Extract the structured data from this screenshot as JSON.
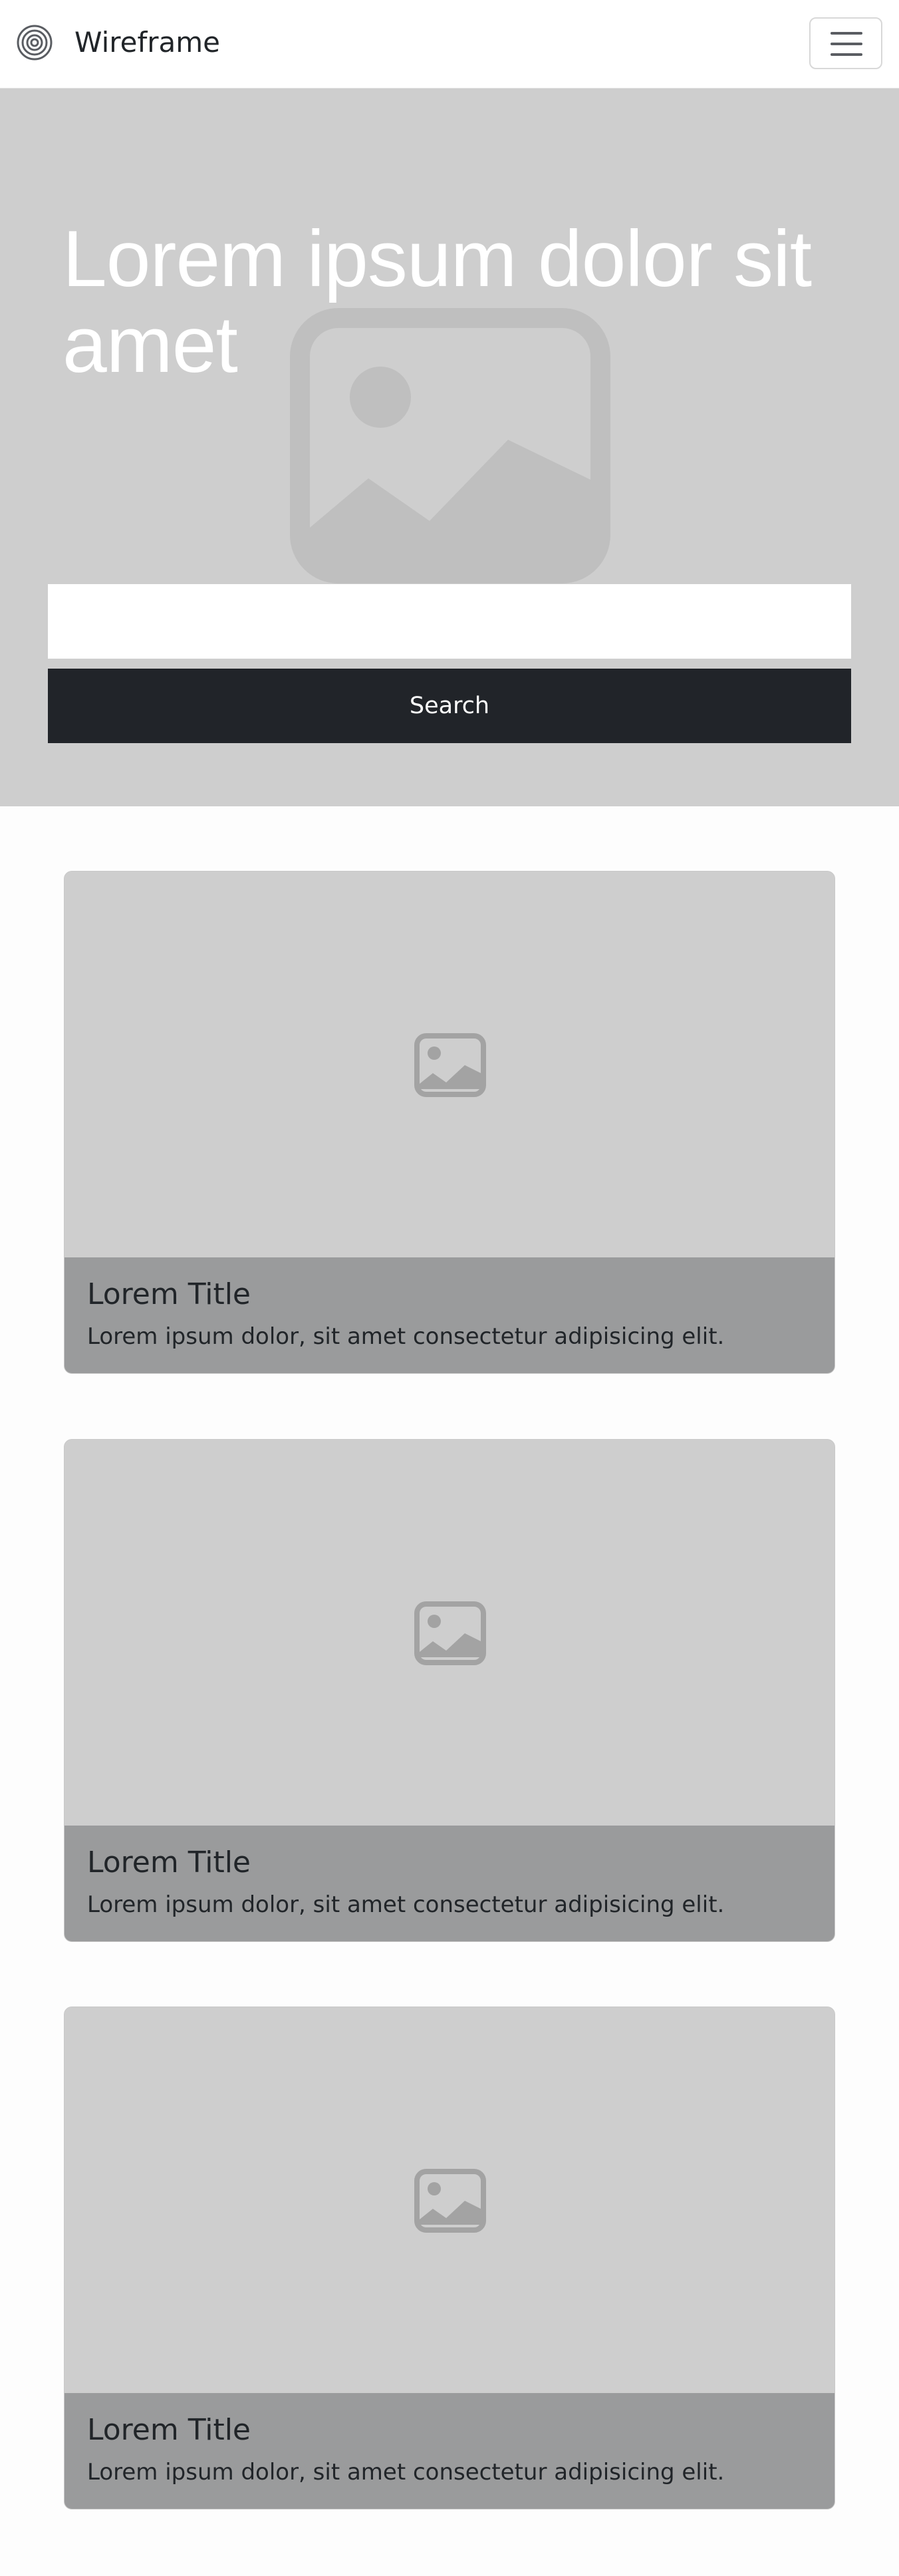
{
  "navbar": {
    "brand": "Wireframe",
    "logo_icon": "concentric-circles-logo",
    "menu_icon": "hamburger-icon"
  },
  "hero": {
    "title": "Lorem ipsum dolor sit amet",
    "search_placeholder": "",
    "search_value": "",
    "search_button_label": "Search",
    "background_color": "#cecece",
    "button_color": "#212429"
  },
  "cards": [
    {
      "title": "Lorem Title",
      "text": "Lorem ipsum dolor, sit amet consectetur adipisicing elit."
    },
    {
      "title": "Lorem Title",
      "text": "Lorem ipsum dolor, sit amet consectetur adipisicing elit."
    },
    {
      "title": "Lorem Title",
      "text": "Lorem ipsum dolor, sit amet consectetur adipisicing elit."
    }
  ],
  "colors": {
    "card_image": "#cecece",
    "card_caption": "#9a9b9c",
    "placeholder_icon": "#a3a3a3"
  }
}
